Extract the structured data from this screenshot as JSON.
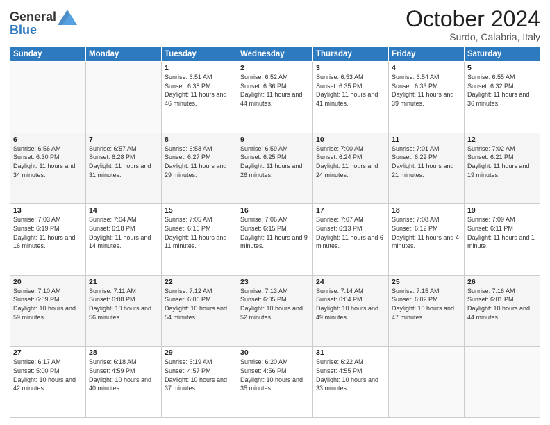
{
  "header": {
    "logo_line1": "General",
    "logo_line2": "Blue",
    "month": "October 2024",
    "location": "Surdo, Calabria, Italy"
  },
  "weekdays": [
    "Sunday",
    "Monday",
    "Tuesday",
    "Wednesday",
    "Thursday",
    "Friday",
    "Saturday"
  ],
  "weeks": [
    [
      {
        "day": "",
        "sunrise": "",
        "sunset": "",
        "daylight": ""
      },
      {
        "day": "",
        "sunrise": "",
        "sunset": "",
        "daylight": ""
      },
      {
        "day": "1",
        "sunrise": "Sunrise: 6:51 AM",
        "sunset": "Sunset: 6:38 PM",
        "daylight": "Daylight: 11 hours and 46 minutes."
      },
      {
        "day": "2",
        "sunrise": "Sunrise: 6:52 AM",
        "sunset": "Sunset: 6:36 PM",
        "daylight": "Daylight: 11 hours and 44 minutes."
      },
      {
        "day": "3",
        "sunrise": "Sunrise: 6:53 AM",
        "sunset": "Sunset: 6:35 PM",
        "daylight": "Daylight: 11 hours and 41 minutes."
      },
      {
        "day": "4",
        "sunrise": "Sunrise: 6:54 AM",
        "sunset": "Sunset: 6:33 PM",
        "daylight": "Daylight: 11 hours and 39 minutes."
      },
      {
        "day": "5",
        "sunrise": "Sunrise: 6:55 AM",
        "sunset": "Sunset: 6:32 PM",
        "daylight": "Daylight: 11 hours and 36 minutes."
      }
    ],
    [
      {
        "day": "6",
        "sunrise": "Sunrise: 6:56 AM",
        "sunset": "Sunset: 6:30 PM",
        "daylight": "Daylight: 11 hours and 34 minutes."
      },
      {
        "day": "7",
        "sunrise": "Sunrise: 6:57 AM",
        "sunset": "Sunset: 6:28 PM",
        "daylight": "Daylight: 11 hours and 31 minutes."
      },
      {
        "day": "8",
        "sunrise": "Sunrise: 6:58 AM",
        "sunset": "Sunset: 6:27 PM",
        "daylight": "Daylight: 11 hours and 29 minutes."
      },
      {
        "day": "9",
        "sunrise": "Sunrise: 6:59 AM",
        "sunset": "Sunset: 6:25 PM",
        "daylight": "Daylight: 11 hours and 26 minutes."
      },
      {
        "day": "10",
        "sunrise": "Sunrise: 7:00 AM",
        "sunset": "Sunset: 6:24 PM",
        "daylight": "Daylight: 11 hours and 24 minutes."
      },
      {
        "day": "11",
        "sunrise": "Sunrise: 7:01 AM",
        "sunset": "Sunset: 6:22 PM",
        "daylight": "Daylight: 11 hours and 21 minutes."
      },
      {
        "day": "12",
        "sunrise": "Sunrise: 7:02 AM",
        "sunset": "Sunset: 6:21 PM",
        "daylight": "Daylight: 11 hours and 19 minutes."
      }
    ],
    [
      {
        "day": "13",
        "sunrise": "Sunrise: 7:03 AM",
        "sunset": "Sunset: 6:19 PM",
        "daylight": "Daylight: 11 hours and 16 minutes."
      },
      {
        "day": "14",
        "sunrise": "Sunrise: 7:04 AM",
        "sunset": "Sunset: 6:18 PM",
        "daylight": "Daylight: 11 hours and 14 minutes."
      },
      {
        "day": "15",
        "sunrise": "Sunrise: 7:05 AM",
        "sunset": "Sunset: 6:16 PM",
        "daylight": "Daylight: 11 hours and 11 minutes."
      },
      {
        "day": "16",
        "sunrise": "Sunrise: 7:06 AM",
        "sunset": "Sunset: 6:15 PM",
        "daylight": "Daylight: 11 hours and 9 minutes."
      },
      {
        "day": "17",
        "sunrise": "Sunrise: 7:07 AM",
        "sunset": "Sunset: 6:13 PM",
        "daylight": "Daylight: 11 hours and 6 minutes."
      },
      {
        "day": "18",
        "sunrise": "Sunrise: 7:08 AM",
        "sunset": "Sunset: 6:12 PM",
        "daylight": "Daylight: 11 hours and 4 minutes."
      },
      {
        "day": "19",
        "sunrise": "Sunrise: 7:09 AM",
        "sunset": "Sunset: 6:11 PM",
        "daylight": "Daylight: 11 hours and 1 minute."
      }
    ],
    [
      {
        "day": "20",
        "sunrise": "Sunrise: 7:10 AM",
        "sunset": "Sunset: 6:09 PM",
        "daylight": "Daylight: 10 hours and 59 minutes."
      },
      {
        "day": "21",
        "sunrise": "Sunrise: 7:11 AM",
        "sunset": "Sunset: 6:08 PM",
        "daylight": "Daylight: 10 hours and 56 minutes."
      },
      {
        "day": "22",
        "sunrise": "Sunrise: 7:12 AM",
        "sunset": "Sunset: 6:06 PM",
        "daylight": "Daylight: 10 hours and 54 minutes."
      },
      {
        "day": "23",
        "sunrise": "Sunrise: 7:13 AM",
        "sunset": "Sunset: 6:05 PM",
        "daylight": "Daylight: 10 hours and 52 minutes."
      },
      {
        "day": "24",
        "sunrise": "Sunrise: 7:14 AM",
        "sunset": "Sunset: 6:04 PM",
        "daylight": "Daylight: 10 hours and 49 minutes."
      },
      {
        "day": "25",
        "sunrise": "Sunrise: 7:15 AM",
        "sunset": "Sunset: 6:02 PM",
        "daylight": "Daylight: 10 hours and 47 minutes."
      },
      {
        "day": "26",
        "sunrise": "Sunrise: 7:16 AM",
        "sunset": "Sunset: 6:01 PM",
        "daylight": "Daylight: 10 hours and 44 minutes."
      }
    ],
    [
      {
        "day": "27",
        "sunrise": "Sunrise: 6:17 AM",
        "sunset": "Sunset: 5:00 PM",
        "daylight": "Daylight: 10 hours and 42 minutes."
      },
      {
        "day": "28",
        "sunrise": "Sunrise: 6:18 AM",
        "sunset": "Sunset: 4:59 PM",
        "daylight": "Daylight: 10 hours and 40 minutes."
      },
      {
        "day": "29",
        "sunrise": "Sunrise: 6:19 AM",
        "sunset": "Sunset: 4:57 PM",
        "daylight": "Daylight: 10 hours and 37 minutes."
      },
      {
        "day": "30",
        "sunrise": "Sunrise: 6:20 AM",
        "sunset": "Sunset: 4:56 PM",
        "daylight": "Daylight: 10 hours and 35 minutes."
      },
      {
        "day": "31",
        "sunrise": "Sunrise: 6:22 AM",
        "sunset": "Sunset: 4:55 PM",
        "daylight": "Daylight: 10 hours and 33 minutes."
      },
      {
        "day": "",
        "sunrise": "",
        "sunset": "",
        "daylight": ""
      },
      {
        "day": "",
        "sunrise": "",
        "sunset": "",
        "daylight": ""
      }
    ]
  ]
}
